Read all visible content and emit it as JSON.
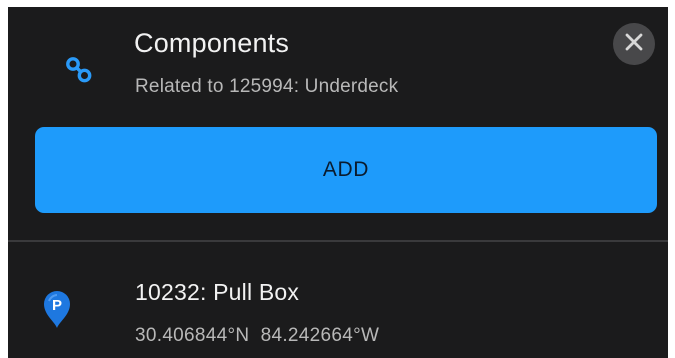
{
  "header": {
    "icon": "link-chain-icon",
    "title": "Components",
    "subtitle": "Related to 125994: Underdeck",
    "close_icon": "close-icon"
  },
  "actions": {
    "add_label": "ADD"
  },
  "items": [
    {
      "icon": "map-pin-p-icon",
      "title": "10232: Pull Box",
      "coords": "30.406844°N  84.242664°W"
    }
  ],
  "colors": {
    "background": "#1b1b1c",
    "accent": "#1e9bfb",
    "close_button_bg": "#48484a",
    "pin": "#1e78e0"
  }
}
